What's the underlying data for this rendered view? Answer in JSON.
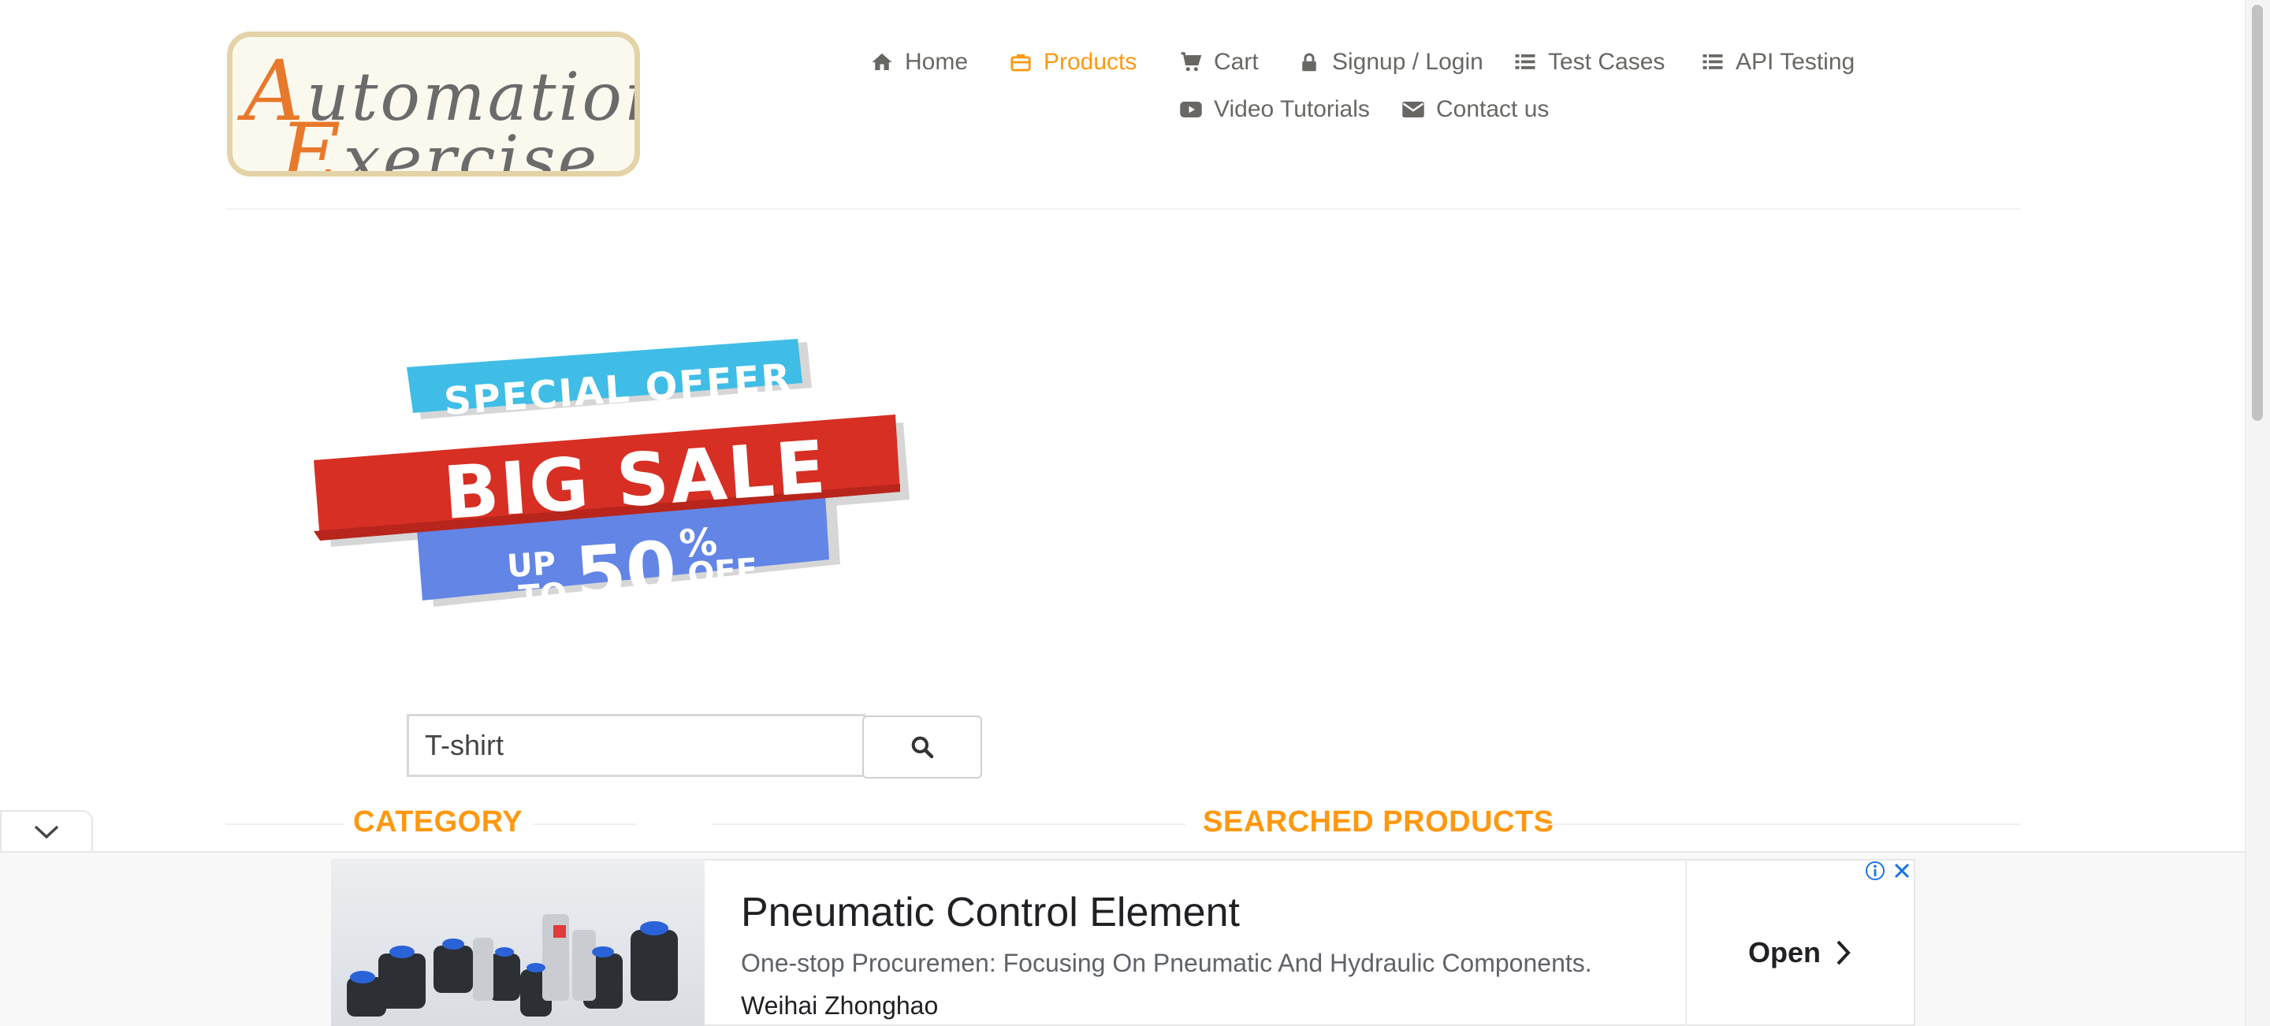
{
  "logo": {
    "line1_cap": "A",
    "line1_rest": "utomation",
    "line2_cap": "E",
    "line2_rest": "xercise"
  },
  "nav": {
    "items": [
      {
        "label": "Home",
        "icon": "home-icon"
      },
      {
        "label": "Products",
        "icon": "briefcase-icon",
        "active": true
      },
      {
        "label": "Cart",
        "icon": "cart-icon"
      },
      {
        "label": "Signup / Login",
        "icon": "lock-icon"
      },
      {
        "label": "Test Cases",
        "icon": "list-icon"
      },
      {
        "label": "API Testing",
        "icon": "list-icon"
      },
      {
        "label": "Video Tutorials",
        "icon": "youtube-icon"
      },
      {
        "label": "Contact us",
        "icon": "envelope-icon"
      }
    ]
  },
  "banner": {
    "line1": "SPECIAL OFFER",
    "line2": "BIG SALE",
    "up": "UP",
    "to": "TO",
    "amount": "50",
    "percent": "%",
    "off": "OFF"
  },
  "search": {
    "value": "T-shirt",
    "icon": "search-icon"
  },
  "sections": {
    "category": "CATEGORY",
    "searched": "SEARCHED PRODUCTS"
  },
  "ad": {
    "title": "Pneumatic Control Element",
    "description": "One-stop Procuremen: Focusing On Pneumatic And Hydraulic Components.",
    "brand": "Weihai Zhonghao",
    "cta": "Open"
  },
  "colors": {
    "accent": "#fe980f",
    "text": "#696763",
    "banner_red": "#d72f24",
    "banner_cyan": "#3fbde6",
    "banner_blue": "#6285e6"
  }
}
